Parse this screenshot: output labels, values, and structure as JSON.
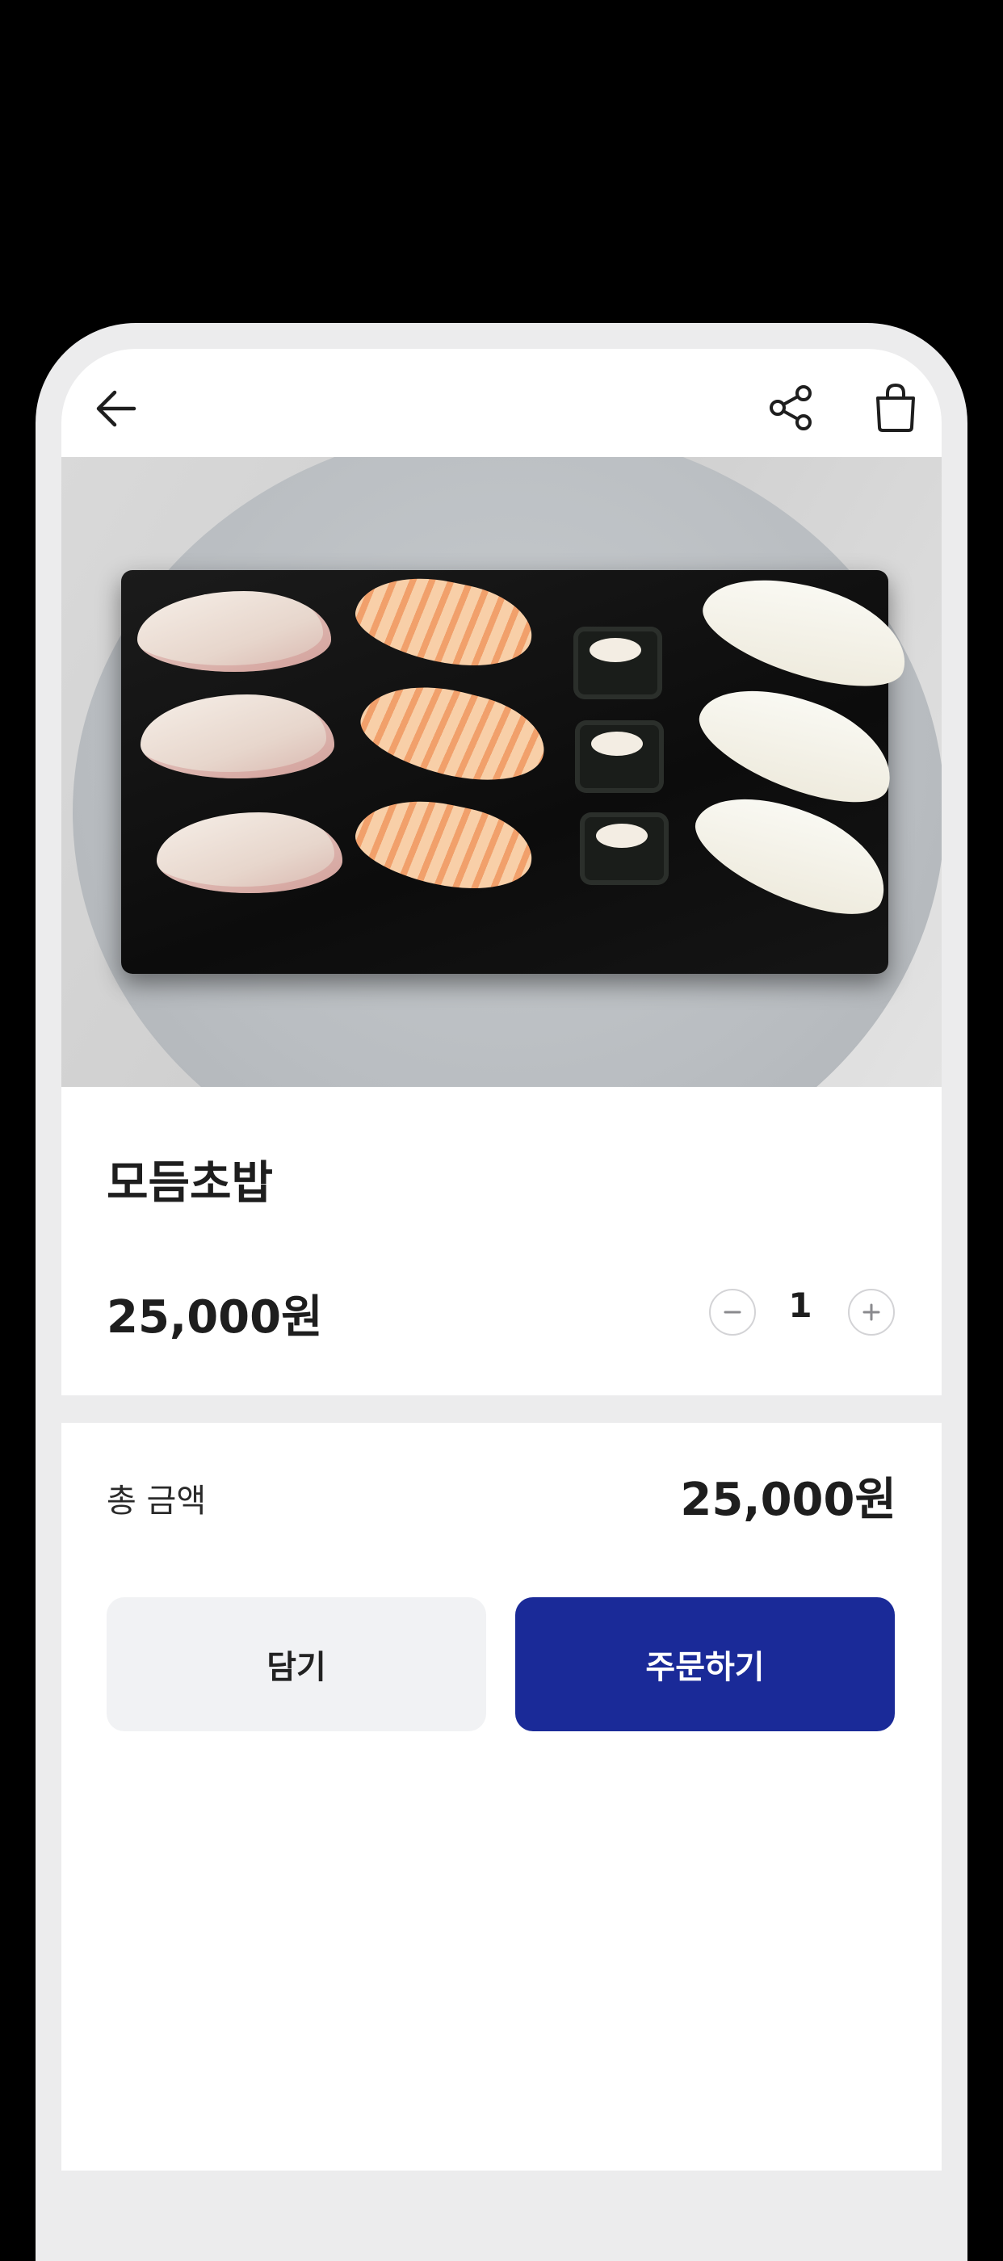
{
  "header": {
    "back_icon": "arrow-left-icon",
    "share_icon": "share-icon",
    "bag_icon": "shopping-bag-icon"
  },
  "product": {
    "name": "모듬초밥",
    "price": "25,000원",
    "quantity": "1"
  },
  "summary": {
    "total_label": "총 금액",
    "total_amount": "25,000원"
  },
  "actions": {
    "cart_label": "담기",
    "order_label": "주문하기"
  },
  "colors": {
    "accent": "#1a2a98",
    "secondary_button": "#f1f2f4",
    "divider": "#ececed"
  }
}
